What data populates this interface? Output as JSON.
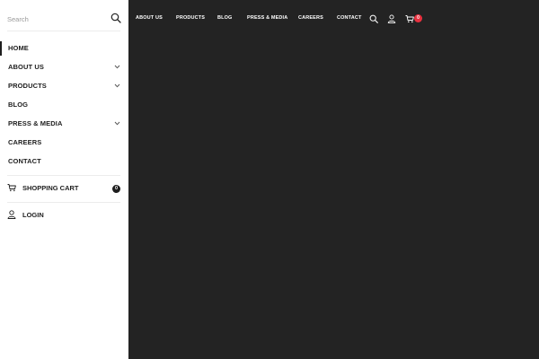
{
  "search": {
    "placeholder": "Search",
    "value": ""
  },
  "sidebar": {
    "menu": [
      {
        "label": "HOME",
        "active": true,
        "has_submenu": false
      },
      {
        "label": "ABOUT US",
        "active": false,
        "has_submenu": true
      },
      {
        "label": "PRODUCTS",
        "active": false,
        "has_submenu": true
      },
      {
        "label": "BLOG",
        "active": false,
        "has_submenu": false
      },
      {
        "label": "PRESS & MEDIA",
        "active": false,
        "has_submenu": true
      },
      {
        "label": "CAREERS",
        "active": false,
        "has_submenu": false
      },
      {
        "label": "CONTACT",
        "active": false,
        "has_submenu": false
      }
    ],
    "cart": {
      "label": "SHOPPING CART",
      "count": "0",
      "icon": "cart-icon"
    },
    "login": {
      "label": "LOGIN",
      "icon": "user-icon"
    }
  },
  "header": {
    "nav": [
      {
        "label": "ABOUT US"
      },
      {
        "label": "PRODUCTS"
      },
      {
        "label": "BLOG"
      },
      {
        "label": "PRESS & MEDIA"
      },
      {
        "label": "CAREERS"
      },
      {
        "label": "CONTACT"
      }
    ],
    "icons": [
      "search-icon",
      "user-icon",
      "cart-icon"
    ],
    "cart_count": "0"
  },
  "colors": {
    "sidebar_bg": "#ffffff",
    "page_bg": "#232323",
    "text_dark": "#1e1e1e",
    "badge_red": "#e8313f"
  }
}
